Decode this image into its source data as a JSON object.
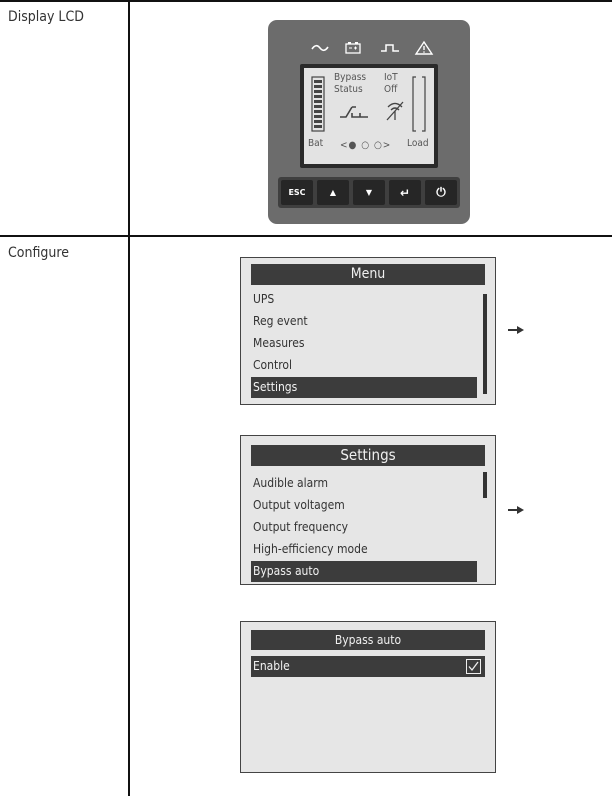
{
  "rows": {
    "display_label": "Display LCD",
    "configure_label": "Configure"
  },
  "lcd": {
    "top_icons": [
      "ac-input-icon",
      "battery-icon",
      "square-wave-icon",
      "warning-icon"
    ],
    "status_left": [
      "Bypass",
      "Status"
    ],
    "status_right": [
      "IoT",
      "Off"
    ],
    "bat_label": "Bat",
    "load_label": "Load",
    "nav_dots": "<● ○ ○>",
    "buttons": [
      "ESC",
      "▲",
      "▼",
      "↵",
      "⏻"
    ]
  },
  "menu_screen": {
    "title": "Menu",
    "items": [
      "UPS",
      "Reg event",
      "Measures",
      "Control",
      "Settings"
    ],
    "selected_index": 4
  },
  "settings_screen": {
    "title": "Settings",
    "items": [
      "Audible alarm",
      "Output voltagem",
      "Output frequency",
      "High-efficiency mode",
      "Bypass auto"
    ],
    "selected_index": 4
  },
  "bypass_screen": {
    "title": "Bypass auto",
    "option_label": "Enable",
    "checked": true
  },
  "colors": {
    "device_body": "#6c6c6c",
    "lcd_background": "#e3e3e3",
    "selection": "#3c3c3c"
  }
}
